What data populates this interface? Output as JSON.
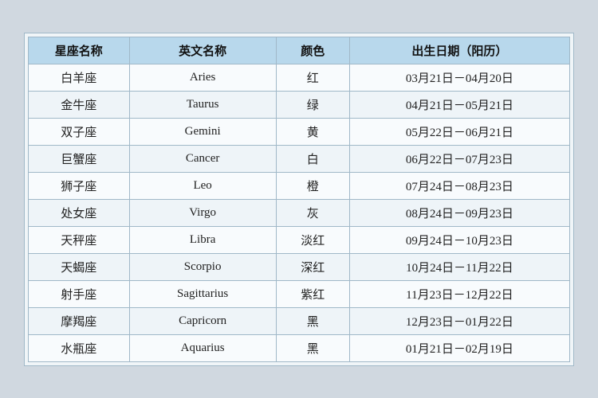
{
  "table": {
    "headers": [
      "星座名称",
      "英文名称",
      "颜色",
      "出生日期（阳历）"
    ],
    "rows": [
      {
        "cn": "白羊座",
        "en": "Aries",
        "color": "红",
        "date": "03月21日－04月20日"
      },
      {
        "cn": "金牛座",
        "en": "Taurus",
        "color": "绿",
        "date": "04月21日－05月21日"
      },
      {
        "cn": "双子座",
        "en": "Gemini",
        "color": "黄",
        "date": "05月22日－06月21日"
      },
      {
        "cn": "巨蟹座",
        "en": "Cancer",
        "color": "白",
        "date": "06月22日－07月23日"
      },
      {
        "cn": "狮子座",
        "en": "Leo",
        "color": "橙",
        "date": "07月24日－08月23日"
      },
      {
        "cn": "处女座",
        "en": "Virgo",
        "color": "灰",
        "date": "08月24日－09月23日"
      },
      {
        "cn": "天秤座",
        "en": "Libra",
        "color": "淡红",
        "date": "09月24日－10月23日"
      },
      {
        "cn": "天蝎座",
        "en": "Scorpio",
        "color": "深红",
        "date": "10月24日－11月22日"
      },
      {
        "cn": "射手座",
        "en": "Sagittarius",
        "color": "紫红",
        "date": "11月23日－12月22日"
      },
      {
        "cn": "摩羯座",
        "en": "Capricorn",
        "color": "黑",
        "date": "12月23日－01月22日"
      },
      {
        "cn": "水瓶座",
        "en": "Aquarius",
        "color": "黑",
        "date": "01月21日－02月19日"
      }
    ]
  }
}
